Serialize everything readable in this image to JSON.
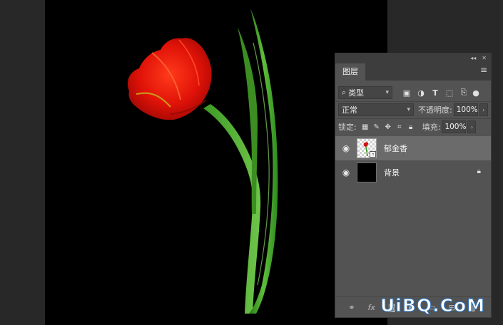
{
  "panel": {
    "collapse_glyph": "◂◂",
    "close_glyph": "✕",
    "tab_label": "图层",
    "menu_icon": "panel-menu-icon"
  },
  "filter": {
    "search_glyph": "⌕",
    "kind_label": "类型",
    "icons": [
      "image-filter-icon",
      "adjustment-filter-icon",
      "type-filter-icon",
      "shape-filter-icon",
      "smart-object-filter-icon"
    ]
  },
  "blend": {
    "mode": "正常",
    "opacity_label": "不透明度:",
    "opacity_value": "100%"
  },
  "lock": {
    "label": "锁定:",
    "fill_label": "填充:",
    "fill_value": "100%"
  },
  "layers": [
    {
      "name": "郁金香",
      "visible": true,
      "selected": true,
      "locked": false,
      "thumbnail": "tulip-thumbnail"
    },
    {
      "name": "背景",
      "visible": true,
      "selected": false,
      "locked": true,
      "thumbnail": "black-thumbnail"
    }
  ],
  "bottom_icons": [
    "link-layers-icon",
    "add-style-icon",
    "add-mask-icon",
    "new-fill-layer-icon",
    "new-group-icon",
    "new-layer-icon",
    "delete-layer-icon"
  ],
  "watermark": "UiBQ.CoM",
  "colors": {
    "canvas": "#000000",
    "panel": "#535353",
    "selected_layer": "#6b6b6b",
    "watermark_outline": "#2e6fb2"
  }
}
